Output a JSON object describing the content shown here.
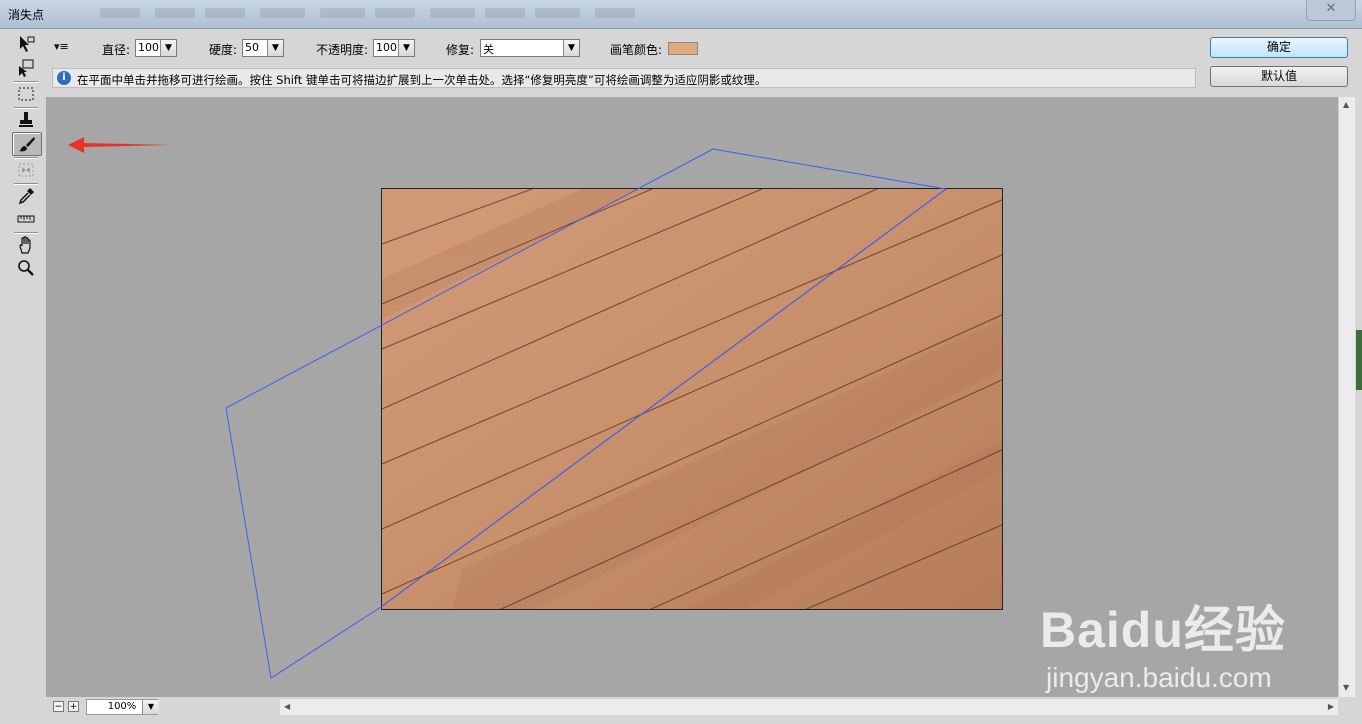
{
  "window": {
    "title": "消失点"
  },
  "toolbar": {
    "tools": [
      "edit-plane-tool",
      "create-plane-tool",
      "marquee-tool",
      "stamp-tool",
      "brush-tool",
      "transform-tool",
      "eyedropper-tool",
      "measure-tool",
      "hand-tool",
      "zoom-tool"
    ],
    "active": "brush-tool"
  },
  "options": {
    "diameter_label": "直径:",
    "diameter_value": "100",
    "hardness_label": "硬度:",
    "hardness_value": "50",
    "opacity_label": "不透明度:",
    "opacity_value": "100",
    "heal_label": "修复:",
    "heal_value": "关",
    "brush_color_label": "画笔颜色:",
    "brush_color": "#e0a980"
  },
  "info": {
    "text": "在平面中单击并拖移可进行绘画。按住 Shift 键单击可将描边扩展到上一次单击处。选择“修复明亮度”可将绘画调整为适应阴影或纹理。"
  },
  "buttons": {
    "ok": "确定",
    "default": "默认值"
  },
  "zoom": {
    "value": "100%"
  },
  "annotation": {
    "arrow_color": "#e8322c",
    "plane_color": "#3b5ff0"
  },
  "watermark": {
    "logo": "Baidu经验",
    "url": "jingyan.baidu.com"
  }
}
